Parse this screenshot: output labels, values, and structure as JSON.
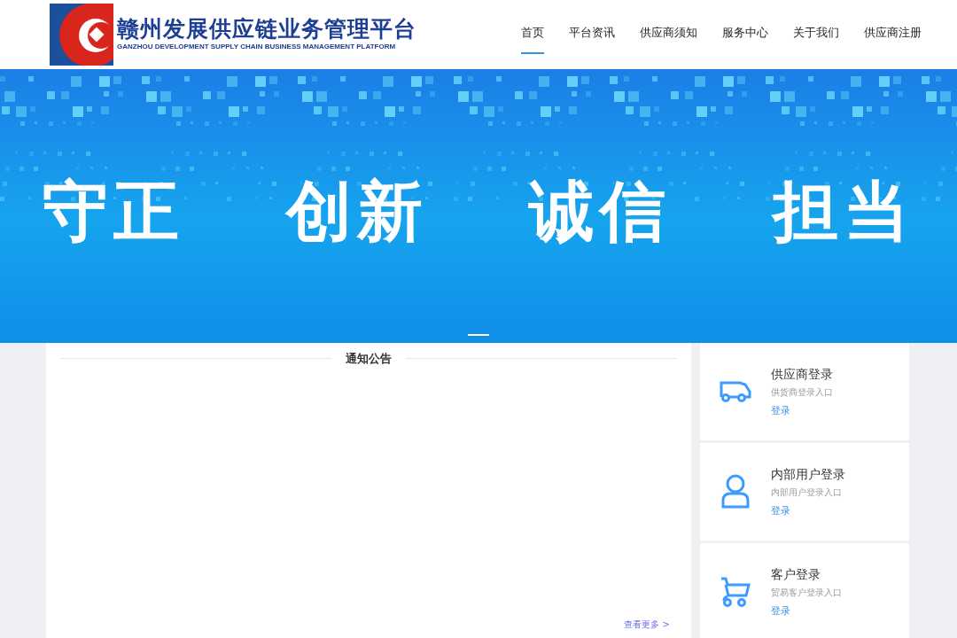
{
  "logo": {
    "title": "赣州发展供应链业务管理平台",
    "subtitle": "GANZHOU DEVELOPMENT SUPPLY CHAIN BUSINESS MANAGEMENT PLATFORM"
  },
  "nav": [
    {
      "label": "首页",
      "selected": true
    },
    {
      "label": "平台资讯",
      "selected": false
    },
    {
      "label": "供应商须知",
      "selected": false
    },
    {
      "label": "服务中心",
      "selected": false
    },
    {
      "label": "关于我们",
      "selected": false
    },
    {
      "label": "供应商注册",
      "selected": false
    }
  ],
  "banner": {
    "slogans": [
      "守正",
      "创新",
      "诚信",
      "担当"
    ],
    "indicators": [
      {
        "selected": true
      }
    ]
  },
  "notices": {
    "title": "通知公告",
    "more": "查看更多 >"
  },
  "logins": [
    {
      "kind": "truck",
      "title": "供应商登录",
      "subtitle": "供货商登录入口",
      "link": "登录"
    },
    {
      "kind": "person",
      "title": "内部用户登录",
      "subtitle": "内部用户登录入口",
      "link": "登录"
    },
    {
      "kind": "cart",
      "title": "客户登录",
      "subtitle": "贸易客户登录入口",
      "link": "登录"
    }
  ]
}
